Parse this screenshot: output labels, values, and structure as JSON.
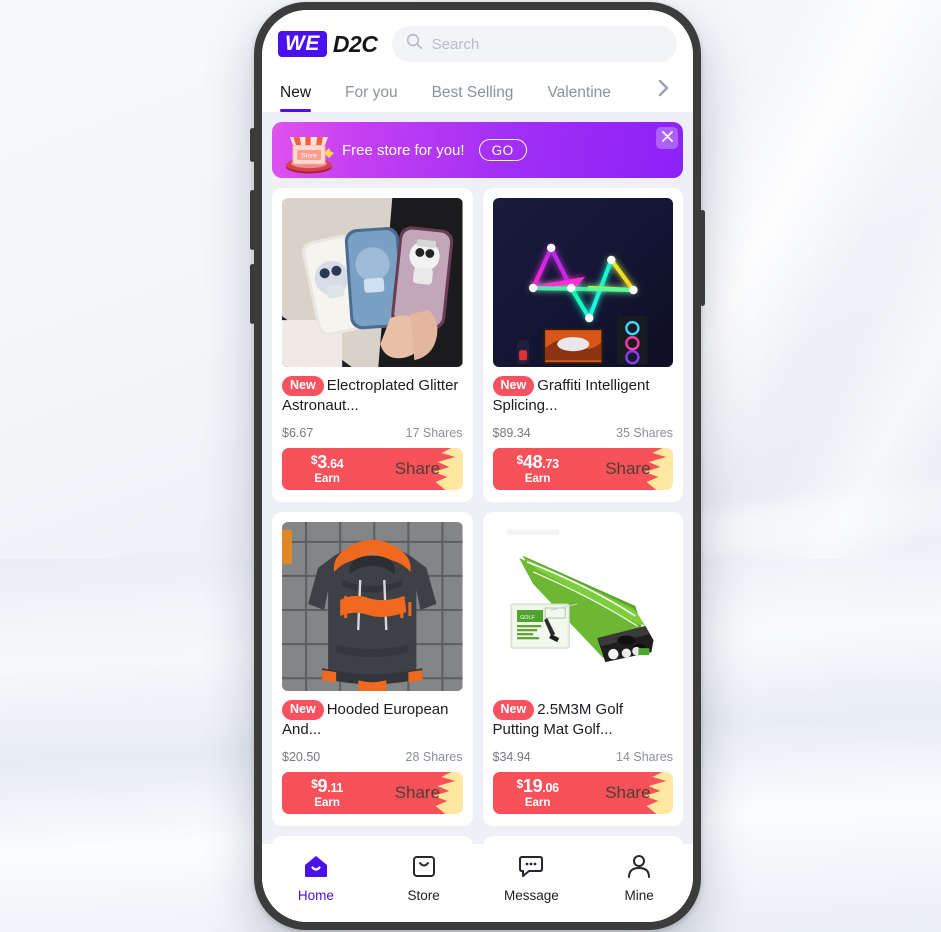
{
  "app": {
    "logo_badge": "WE",
    "logo_text": "D2C"
  },
  "search": {
    "placeholder": "Search",
    "icon": "search-icon"
  },
  "tabs": {
    "items": [
      {
        "label": "New",
        "active": true
      },
      {
        "label": "For you",
        "active": false
      },
      {
        "label": "Best Selling",
        "active": false
      },
      {
        "label": "Valentine",
        "active": false
      }
    ],
    "more_icon": "chevron-right-icon"
  },
  "promo": {
    "text": "Free store for you!",
    "cta": "GO",
    "icon": "store-icon",
    "close_icon": "close-icon",
    "gradient_from": "#e152f0",
    "gradient_to": "#8b22f7"
  },
  "products": [
    {
      "badge": "New",
      "title": "Electroplated Glitter Astronaut...",
      "price": "$6.67",
      "shares": "17 Shares",
      "earn_currency": "$",
      "earn_whole": "3",
      "earn_cents": ".64",
      "earn_label": "Earn",
      "share_label": "Share",
      "image": "phone-cases-glitter-astronaut"
    },
    {
      "badge": "New",
      "title": "Graffiti Intelligent Splicing...",
      "price": "$89.34",
      "shares": "35 Shares",
      "earn_currency": "$",
      "earn_whole": "48",
      "earn_cents": ".73",
      "earn_label": "Earn",
      "share_label": "Share",
      "image": "neon-rgb-wall-lights"
    },
    {
      "badge": "New",
      "title": "Hooded European And...",
      "price": "$20.50",
      "shares": "28 Shares",
      "earn_currency": "$",
      "earn_whole": "9",
      "earn_cents": ".11",
      "earn_label": "Earn",
      "share_label": "Share",
      "image": "orange-grey-hoodie"
    },
    {
      "badge": "New",
      "title": "2.5M3M Golf Putting Mat Golf...",
      "price": "$34.94",
      "shares": "14 Shares",
      "earn_currency": "$",
      "earn_whole": "19",
      "earn_cents": ".06",
      "earn_label": "Earn",
      "share_label": "Share",
      "image": "green-golf-putting-mat"
    }
  ],
  "bottom_nav": {
    "items": [
      {
        "label": "Home",
        "icon": "home-icon",
        "active": true
      },
      {
        "label": "Store",
        "icon": "store-bag-icon",
        "active": false
      },
      {
        "label": "Message",
        "icon": "message-icon",
        "active": false
      },
      {
        "label": "Mine",
        "icon": "person-icon",
        "active": false
      }
    ],
    "active_color": "#4a11ee"
  },
  "colors": {
    "brand_purple": "#4a11ee",
    "badge_red": "#f8515f",
    "earn_red": "#f84a52",
    "share_yellow": "#ffd24d"
  }
}
